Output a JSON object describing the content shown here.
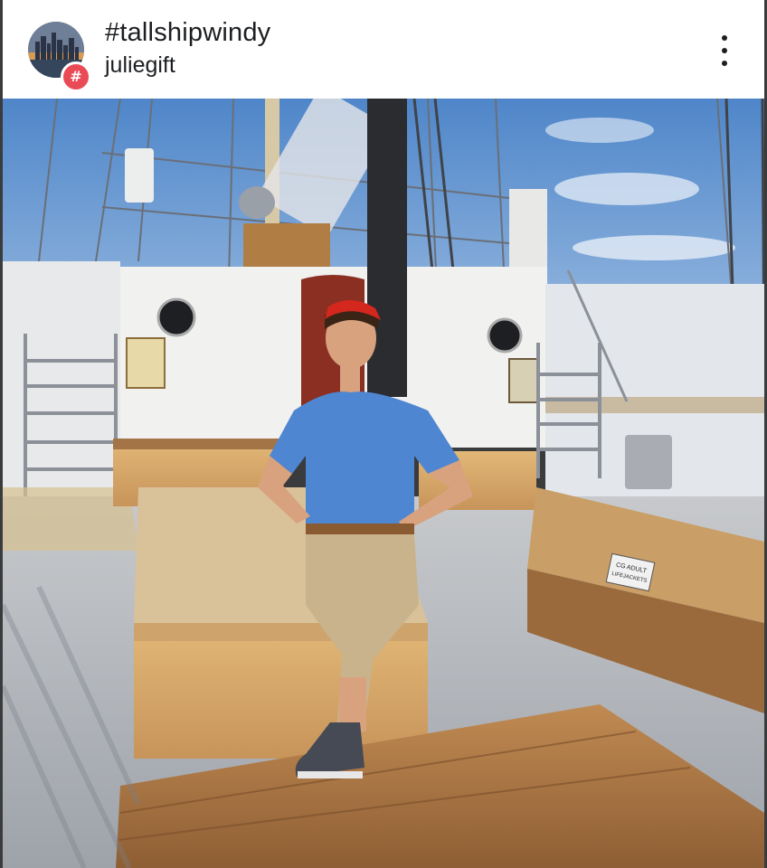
{
  "post": {
    "hashtag_title": "#tallshipwindy",
    "username": "juliegift",
    "badge_symbol": "#",
    "avatar_icon": "city-skyline-icon",
    "menu_icon": "more-options-icon"
  },
  "photo": {
    "sign_text_line1": "CG ADULT",
    "sign_text_line2": "LIFEJACKETS"
  },
  "colors": {
    "badge": "#e94a56",
    "sky": "#5b8fcf",
    "shirt": "#4f86d1",
    "deck_wood": "#b8834e"
  }
}
